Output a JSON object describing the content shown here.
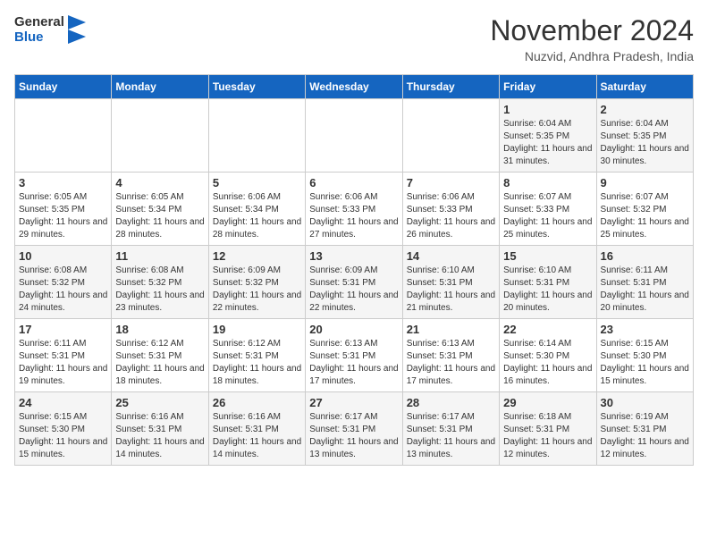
{
  "header": {
    "logo_line1": "General",
    "logo_line2": "Blue",
    "month": "November 2024",
    "location": "Nuzvid, Andhra Pradesh, India"
  },
  "weekdays": [
    "Sunday",
    "Monday",
    "Tuesday",
    "Wednesday",
    "Thursday",
    "Friday",
    "Saturday"
  ],
  "weeks": [
    [
      {
        "day": "",
        "info": ""
      },
      {
        "day": "",
        "info": ""
      },
      {
        "day": "",
        "info": ""
      },
      {
        "day": "",
        "info": ""
      },
      {
        "day": "",
        "info": ""
      },
      {
        "day": "1",
        "info": "Sunrise: 6:04 AM\nSunset: 5:35 PM\nDaylight: 11 hours and 31 minutes."
      },
      {
        "day": "2",
        "info": "Sunrise: 6:04 AM\nSunset: 5:35 PM\nDaylight: 11 hours and 30 minutes."
      }
    ],
    [
      {
        "day": "3",
        "info": "Sunrise: 6:05 AM\nSunset: 5:35 PM\nDaylight: 11 hours and 29 minutes."
      },
      {
        "day": "4",
        "info": "Sunrise: 6:05 AM\nSunset: 5:34 PM\nDaylight: 11 hours and 28 minutes."
      },
      {
        "day": "5",
        "info": "Sunrise: 6:06 AM\nSunset: 5:34 PM\nDaylight: 11 hours and 28 minutes."
      },
      {
        "day": "6",
        "info": "Sunrise: 6:06 AM\nSunset: 5:33 PM\nDaylight: 11 hours and 27 minutes."
      },
      {
        "day": "7",
        "info": "Sunrise: 6:06 AM\nSunset: 5:33 PM\nDaylight: 11 hours and 26 minutes."
      },
      {
        "day": "8",
        "info": "Sunrise: 6:07 AM\nSunset: 5:33 PM\nDaylight: 11 hours and 25 minutes."
      },
      {
        "day": "9",
        "info": "Sunrise: 6:07 AM\nSunset: 5:32 PM\nDaylight: 11 hours and 25 minutes."
      }
    ],
    [
      {
        "day": "10",
        "info": "Sunrise: 6:08 AM\nSunset: 5:32 PM\nDaylight: 11 hours and 24 minutes."
      },
      {
        "day": "11",
        "info": "Sunrise: 6:08 AM\nSunset: 5:32 PM\nDaylight: 11 hours and 23 minutes."
      },
      {
        "day": "12",
        "info": "Sunrise: 6:09 AM\nSunset: 5:32 PM\nDaylight: 11 hours and 22 minutes."
      },
      {
        "day": "13",
        "info": "Sunrise: 6:09 AM\nSunset: 5:31 PM\nDaylight: 11 hours and 22 minutes."
      },
      {
        "day": "14",
        "info": "Sunrise: 6:10 AM\nSunset: 5:31 PM\nDaylight: 11 hours and 21 minutes."
      },
      {
        "day": "15",
        "info": "Sunrise: 6:10 AM\nSunset: 5:31 PM\nDaylight: 11 hours and 20 minutes."
      },
      {
        "day": "16",
        "info": "Sunrise: 6:11 AM\nSunset: 5:31 PM\nDaylight: 11 hours and 20 minutes."
      }
    ],
    [
      {
        "day": "17",
        "info": "Sunrise: 6:11 AM\nSunset: 5:31 PM\nDaylight: 11 hours and 19 minutes."
      },
      {
        "day": "18",
        "info": "Sunrise: 6:12 AM\nSunset: 5:31 PM\nDaylight: 11 hours and 18 minutes."
      },
      {
        "day": "19",
        "info": "Sunrise: 6:12 AM\nSunset: 5:31 PM\nDaylight: 11 hours and 18 minutes."
      },
      {
        "day": "20",
        "info": "Sunrise: 6:13 AM\nSunset: 5:31 PM\nDaylight: 11 hours and 17 minutes."
      },
      {
        "day": "21",
        "info": "Sunrise: 6:13 AM\nSunset: 5:31 PM\nDaylight: 11 hours and 17 minutes."
      },
      {
        "day": "22",
        "info": "Sunrise: 6:14 AM\nSunset: 5:30 PM\nDaylight: 11 hours and 16 minutes."
      },
      {
        "day": "23",
        "info": "Sunrise: 6:15 AM\nSunset: 5:30 PM\nDaylight: 11 hours and 15 minutes."
      }
    ],
    [
      {
        "day": "24",
        "info": "Sunrise: 6:15 AM\nSunset: 5:30 PM\nDaylight: 11 hours and 15 minutes."
      },
      {
        "day": "25",
        "info": "Sunrise: 6:16 AM\nSunset: 5:31 PM\nDaylight: 11 hours and 14 minutes."
      },
      {
        "day": "26",
        "info": "Sunrise: 6:16 AM\nSunset: 5:31 PM\nDaylight: 11 hours and 14 minutes."
      },
      {
        "day": "27",
        "info": "Sunrise: 6:17 AM\nSunset: 5:31 PM\nDaylight: 11 hours and 13 minutes."
      },
      {
        "day": "28",
        "info": "Sunrise: 6:17 AM\nSunset: 5:31 PM\nDaylight: 11 hours and 13 minutes."
      },
      {
        "day": "29",
        "info": "Sunrise: 6:18 AM\nSunset: 5:31 PM\nDaylight: 11 hours and 12 minutes."
      },
      {
        "day": "30",
        "info": "Sunrise: 6:19 AM\nSunset: 5:31 PM\nDaylight: 11 hours and 12 minutes."
      }
    ]
  ]
}
